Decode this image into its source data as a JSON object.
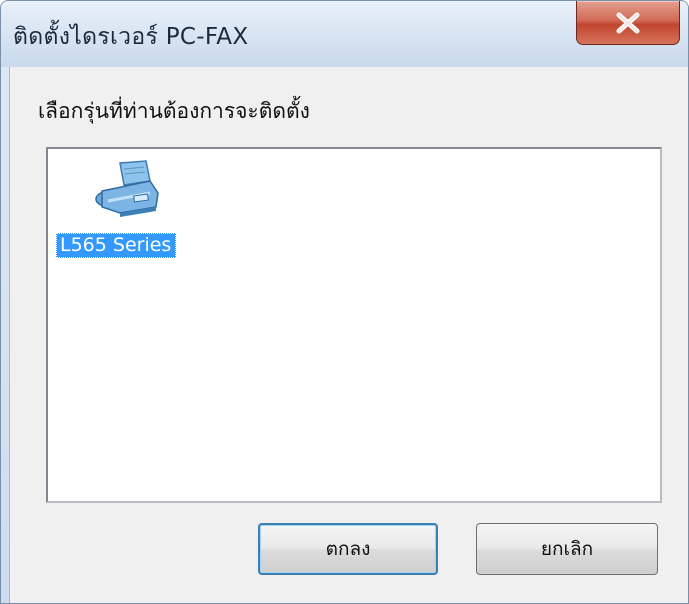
{
  "window": {
    "title": "ติดตั้งไดรเวอร์ PC-FAX",
    "close_icon": "close-icon"
  },
  "dialog": {
    "prompt": "เลือกรุ่นที่ท่านต้องการจะติดตั้ง",
    "models": [
      {
        "label": "L565 Series",
        "icon": "fax-printer-icon",
        "selected": true
      }
    ],
    "ok_label": "ตกลง",
    "cancel_label": "ยกเลิก"
  },
  "colors": {
    "selection": "#3399ff",
    "close_button": "#c0452e",
    "default_button_border": "#3c7fb1"
  }
}
